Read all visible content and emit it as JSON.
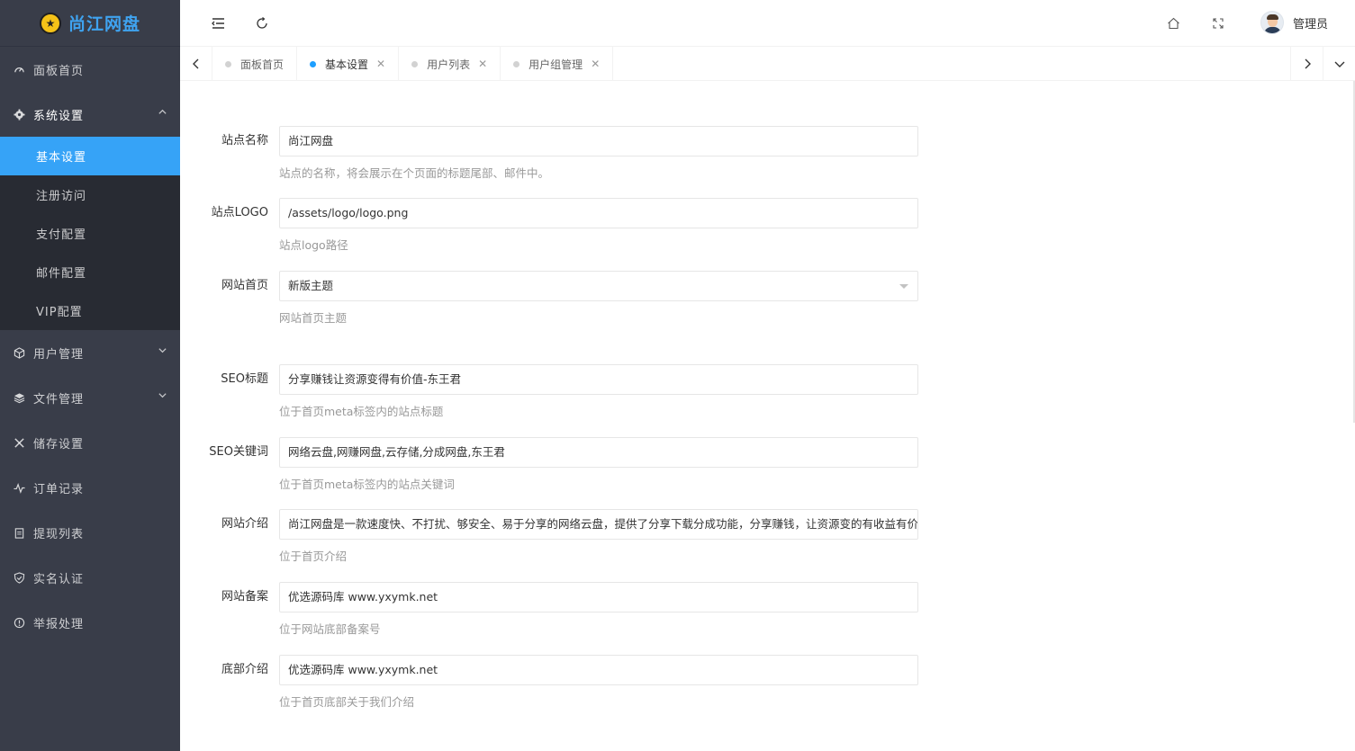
{
  "brand": {
    "name": "尚江网盘",
    "logo_icon": "mascot-logo"
  },
  "sidebar": {
    "items": [
      {
        "label": "面板首页",
        "icon": "dashboard-icon"
      },
      {
        "label": "系统设置",
        "icon": "gear-icon",
        "expanded": true,
        "children": [
          {
            "label": "基本设置",
            "active": true
          },
          {
            "label": "注册访问"
          },
          {
            "label": "支付配置"
          },
          {
            "label": "邮件配置"
          },
          {
            "label": "VIP配置"
          }
        ]
      },
      {
        "label": "用户管理",
        "icon": "cube-icon"
      },
      {
        "label": "文件管理",
        "icon": "layers-icon"
      },
      {
        "label": "储存设置",
        "icon": "tools-icon"
      },
      {
        "label": "订单记录",
        "icon": "pulse-icon"
      },
      {
        "label": "提现列表",
        "icon": "clipboard-icon"
      },
      {
        "label": "实名认证",
        "icon": "shield-icon"
      },
      {
        "label": "举报处理",
        "icon": "alert-icon"
      }
    ],
    "colors": {
      "bg": "#393d49",
      "active": "#36a3f7",
      "sub_bg": "#282b33"
    }
  },
  "header": {
    "user_name": "管理员",
    "icons": [
      "menu-fold-icon",
      "refresh-icon",
      "home-icon",
      "fullscreen-icon"
    ]
  },
  "tabs": [
    {
      "label": "面板首页",
      "active": false,
      "closable": false
    },
    {
      "label": "基本设置",
      "active": true,
      "closable": true
    },
    {
      "label": "用户列表",
      "active": false,
      "closable": true
    },
    {
      "label": "用户组管理",
      "active": false,
      "closable": true
    }
  ],
  "form": {
    "fields": [
      {
        "label": "站点名称",
        "value": "尚江网盘",
        "hint": "站点的名称，将会展示在个页面的标题尾部、邮件中。",
        "type": "text"
      },
      {
        "label": "站点LOGO",
        "value": "/assets/logo/logo.png",
        "hint": "站点logo路径",
        "type": "text"
      },
      {
        "label": "网站首页",
        "value": "新版主题",
        "hint": "网站首页主题",
        "type": "select"
      },
      {
        "label": "SEO标题",
        "value": "分享赚钱让资源变得有价值-东王君",
        "hint": "位于首页meta标签内的站点标题",
        "type": "text"
      },
      {
        "label": "SEO关键词",
        "value": "网络云盘,网赚网盘,云存储,分成网盘,东王君",
        "hint": "位于首页meta标签内的站点关键词",
        "type": "text"
      },
      {
        "label": "网站介绍",
        "value": "尚江网盘是一款速度快、不打扰、够安全、易于分享的网络云盘，提供了分享下载分成功能，分享赚钱，让资源变的有收益有价值",
        "hint": "位于首页介绍",
        "type": "text"
      },
      {
        "label": "网站备案",
        "value": "优选源码库  www.yxymk.net",
        "hint": "位于网站底部备案号",
        "type": "text"
      },
      {
        "label": "底部介绍",
        "value": "优选源码库  www.yxymk.net",
        "hint": "位于首页底部关于我们介绍",
        "type": "text"
      }
    ]
  }
}
